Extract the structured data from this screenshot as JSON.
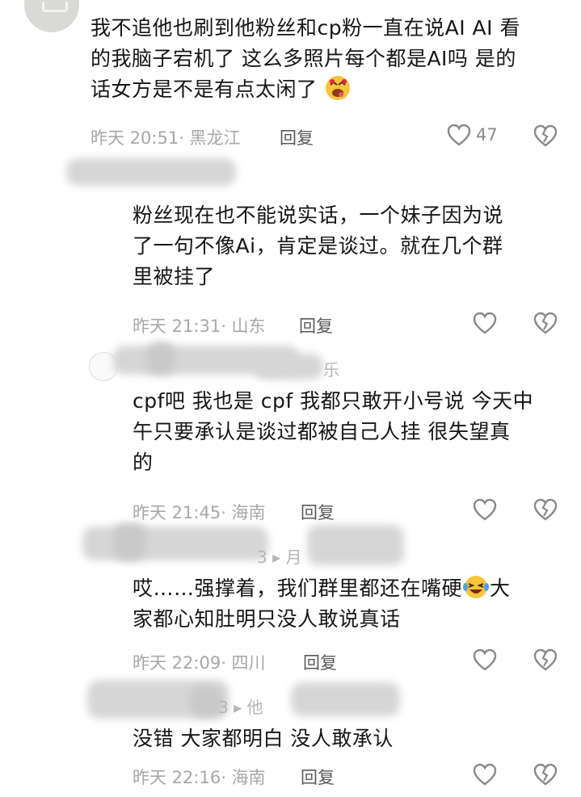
{
  "comments": [
    {
      "lines": [
        "我不追他也刷到他粉丝和cp粉一直在说AI AI 看",
        "的我脑子宕机了 这么多照片每个都是AI吗 是的",
        "话女方是不是有点太闲了"
      ],
      "meta": "昨天 20:51· 黑龙江",
      "reply": "回复",
      "likes": "47"
    },
    {
      "lines": [
        "粉丝现在也不能说实话，一个妹子因为说",
        "了一句不像Ai，肯定是谈过。就在几个群",
        "里被挂了"
      ],
      "meta": "昨天 21:31· 山东",
      "reply": "回复"
    },
    {
      "ghost": "乐",
      "lines": [
        "cpf吧 我也是 cpf 我都只敢开小号说 今天中",
        "午只要承认是谈过都被自己人挂 很失望真",
        "的"
      ],
      "meta": "昨天 21:45· 海南",
      "reply": "回复"
    },
    {
      "ghost": "3 ▸ 月",
      "lines": [
        "哎……强撑着，我们群里都还在嘴硬",
        "家都心知肚明只没人敢说真话"
      ],
      "line1_tail": "大",
      "meta": "昨天 22:09· 四川",
      "reply": "回复"
    },
    {
      "ghost": "3 ▸ 他",
      "lines": [
        "没错 大家都明白 没人敢承认"
      ],
      "meta": "昨天 22:16· 海南",
      "reply": "回复"
    }
  ],
  "icons": {
    "like": "heart-outline-icon",
    "dislike": "broken-heart-icon",
    "emoji_drool": "drooling-face-emoji",
    "emoji_laugh": "laughing-tears-emoji"
  },
  "colors": {
    "meta": "#a7a7a7",
    "reply": "#5a5a5a",
    "text": "#161616",
    "icon": "#8a8a8a"
  }
}
